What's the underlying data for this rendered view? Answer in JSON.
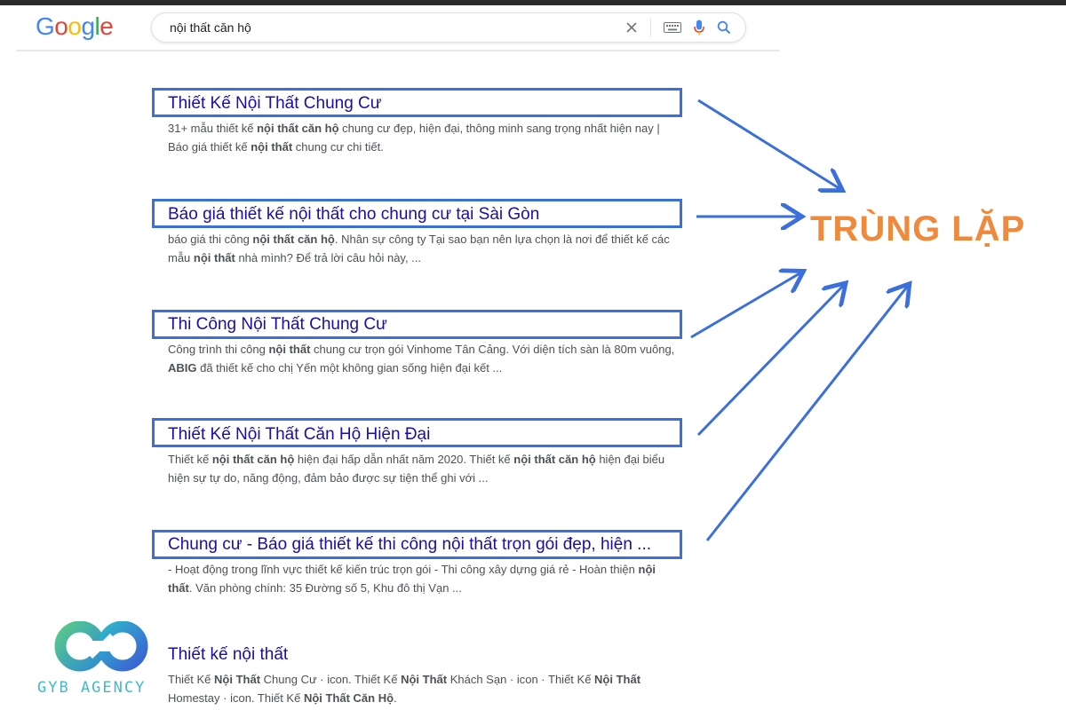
{
  "header": {
    "logo_letters": [
      {
        "ch": "G",
        "color": "#4285F4"
      },
      {
        "ch": "o",
        "color": "#EA4335"
      },
      {
        "ch": "o",
        "color": "#FBBC05"
      },
      {
        "ch": "g",
        "color": "#4285F4"
      },
      {
        "ch": "l",
        "color": "#34A853"
      },
      {
        "ch": "e",
        "color": "#EA4335"
      }
    ],
    "search_query": "nội thất căn hộ",
    "icons": [
      "clear-icon",
      "keyboard-icon",
      "microphone-icon",
      "search-icon"
    ]
  },
  "results": [
    {
      "title": "Thiết Kế Nội Thất Chung Cư",
      "snippet": [
        {
          "t": "31+ mẫu thiết kế "
        },
        {
          "t": "nội thất căn hộ",
          "b": true
        },
        {
          "t": " chung cư đẹp, hiện đại, thông minh sang trọng nhất hiện nay | Báo giá thiết kế "
        },
        {
          "t": "nội thất",
          "b": true
        },
        {
          "t": " chung cư chi tiết."
        }
      ]
    },
    {
      "title": "Báo giá thiết kế nội thất cho chung cư tại Sài Gòn",
      "snippet": [
        {
          "t": "báo giá thi công "
        },
        {
          "t": "nội thất căn hộ",
          "b": true
        },
        {
          "t": ". Nhân sự công ty          Tại sao bạn nên lựa chọn         là nơi để thiết kế các mẫu "
        },
        {
          "t": "nội thất",
          "b": true
        },
        {
          "t": " nhà mình? Để trả lời câu hỏi này, ..."
        }
      ]
    },
    {
      "title": "Thi Công Nội Thất Chung Cư",
      "snippet": [
        {
          "t": "Công trình thi công "
        },
        {
          "t": "nội thất",
          "b": true
        },
        {
          "t": " chung cư trọn gói Vinhome Tân Cảng. Với diện tích sàn là 80m vuông, "
        },
        {
          "t": "ABIG",
          "b": true
        },
        {
          "t": " đã thiết kế cho chị Yến một không gian sống hiện đại kết ..."
        }
      ]
    },
    {
      "title": "Thiết Kế Nội Thất Căn Hộ Hiện Đại",
      "snippet": [
        {
          "t": "Thiết kế "
        },
        {
          "t": "nội thất căn hộ",
          "b": true
        },
        {
          "t": " hiện đại hấp dẫn nhất năm 2020. Thiết kế "
        },
        {
          "t": "nội thất căn hộ",
          "b": true
        },
        {
          "t": " hiện đại biểu hiện sự tự do, năng động, đảm bảo được sự tiện thể ghi với ..."
        }
      ]
    },
    {
      "title": "Chung cư - Báo giá thiết kế thi công nội thất trọn gói đẹp, hiện ...",
      "snippet": [
        {
          "t": "         - Hoạt động trong lĩnh vực thiết kế kiến trúc trọn gói - Thi công xây dựng giá rẻ - Hoàn thiện "
        },
        {
          "t": "nội thất",
          "b": true
        },
        {
          "t": ". Văn phòng chính: 35 Đường số 5, Khu đô thị Vạn ..."
        }
      ]
    },
    {
      "title": "Thiết kế nội thất",
      "snippet": [
        {
          "t": "Thiết Kế "
        },
        {
          "t": "Nội Thất",
          "b": true
        },
        {
          "t": " Chung Cư · icon. Thiết Kế "
        },
        {
          "t": "Nội Thất",
          "b": true
        },
        {
          "t": " Khách Sạn · icon · Thiết Kế "
        },
        {
          "t": "Nội Thất",
          "b": true
        },
        {
          "t": " Homestay · icon. Thiết Kế "
        },
        {
          "t": "Nội Thất Căn Hộ",
          "b": true
        },
        {
          "t": "."
        }
      ]
    }
  ],
  "annotation": {
    "label": "TRÙNG LẶP",
    "label_color": "#ef8a3c",
    "box_color": "#3b6fdc"
  },
  "watermark": {
    "text": "GYB AGENCY"
  }
}
